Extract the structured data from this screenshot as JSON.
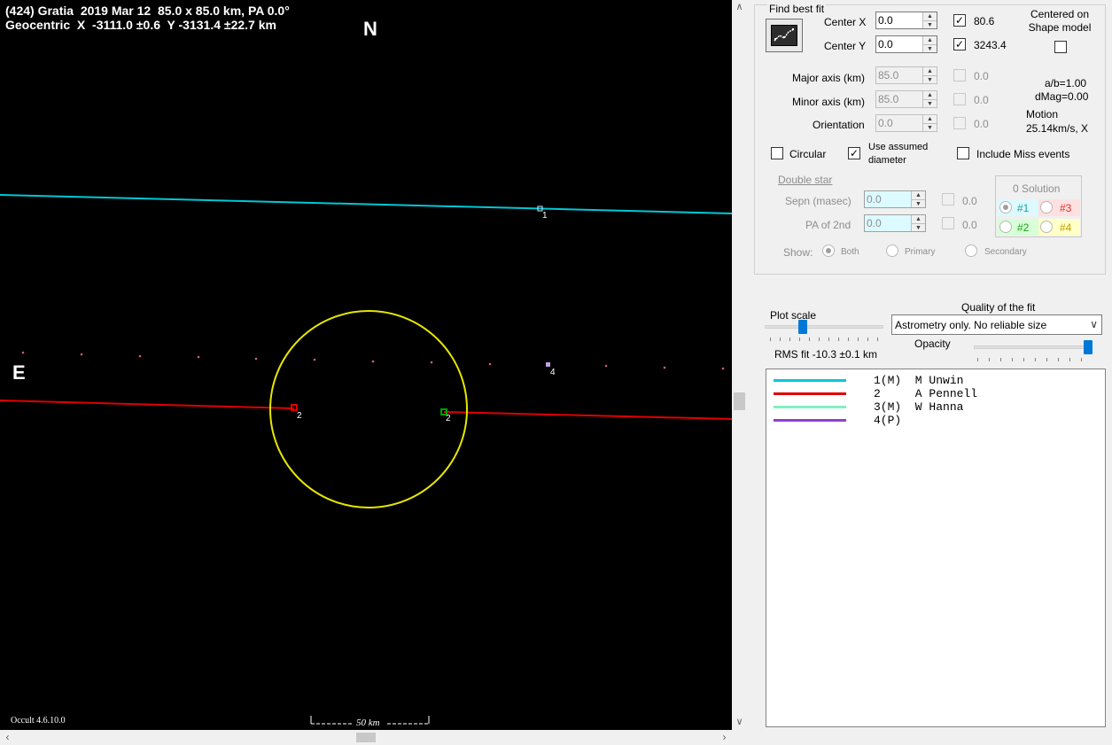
{
  "plot": {
    "title_line1": "(424) Gratia  2019 Mar 12  85.0 x 85.0 km, PA 0.0°",
    "title_line2": "Geocentric  X  -3111.0 ±0.6  Y -3131.4 ±22.7 km",
    "north_label": "N",
    "east_label": "E",
    "version": "Occult 4.6.10.0",
    "scale_label": "50 km",
    "chord_labels": [
      "1",
      "2",
      "2",
      "4"
    ],
    "colors": {
      "background": "#000000",
      "ellipse": "#e6e600",
      "chord1": "#00c8d8",
      "chord2": "#e00000",
      "dots": "#d06070",
      "disappear": "#e00000",
      "reappear": "#00a000",
      "chord4_marker": "#c0a0e0"
    }
  },
  "panel": {
    "group_title": "Find best fit",
    "fit_button_icon": "chart-fit-icon",
    "center_x": {
      "label": "Center X",
      "value": "0.0",
      "checked": true,
      "result": "80.6"
    },
    "center_y": {
      "label": "Center Y",
      "value": "0.0",
      "checked": true,
      "result": "3243.4"
    },
    "centered_on": {
      "label": "Centered on\nShape model",
      "checked": false
    },
    "major_axis": {
      "label": "Major axis (km)",
      "value": "85.0",
      "checked": false,
      "result": "0.0"
    },
    "minor_axis": {
      "label": "Minor axis (km)",
      "value": "85.0",
      "checked": false,
      "result": "0.0"
    },
    "orientation": {
      "label": "Orientation",
      "value": "0.0",
      "checked": false,
      "result": "0.0"
    },
    "ab_ratio": "a/b=1.00",
    "dmag": "dMag=0.00",
    "motion_label": "Motion",
    "motion_value": "25.14km/s, X",
    "circular": {
      "label": "Circular",
      "checked": false
    },
    "use_assumed": {
      "label": "Use assumed\ndiameter",
      "checked": true
    },
    "include_miss": {
      "label": "Include Miss events",
      "checked": false
    },
    "double_star": {
      "title": "Double star",
      "sepn": {
        "label": "Sepn (masec)",
        "value": "0.0",
        "result": "0.0"
      },
      "pa2": {
        "label": "PA of 2nd",
        "value": "0.0",
        "result": "0.0"
      }
    },
    "solution": {
      "title": "0 Solution",
      "options": [
        {
          "label": "#1",
          "color": "#dcfaff",
          "selected": true
        },
        {
          "label": "#3",
          "color": "#ffe0e0",
          "selected": false
        },
        {
          "label": "#2",
          "color": "#d8ffd8",
          "selected": false
        },
        {
          "label": "#4",
          "color": "#ffffc8",
          "selected": false
        }
      ]
    },
    "show": {
      "label": "Show:",
      "options": [
        {
          "label": "Both",
          "selected": true
        },
        {
          "label": "Primary",
          "selected": false
        },
        {
          "label": "Secondary",
          "selected": false
        }
      ]
    },
    "plot_scale_label": "Plot scale",
    "quality_label": "Quality of the fit",
    "quality_value": "Astrometry only. No reliable size",
    "opacity_label": "Opacity",
    "rms_fit": "RMS fit -10.3 ±0.1 km",
    "observers": [
      {
        "text": "1(M)  M Unwin",
        "color": "#00c8d8"
      },
      {
        "text": "2     A Pennell",
        "color": "#e00000"
      },
      {
        "text": "3(M)  W Hanna",
        "color": "#80f0c0"
      },
      {
        "text": "4(P)",
        "color": "#9040d0"
      }
    ]
  }
}
